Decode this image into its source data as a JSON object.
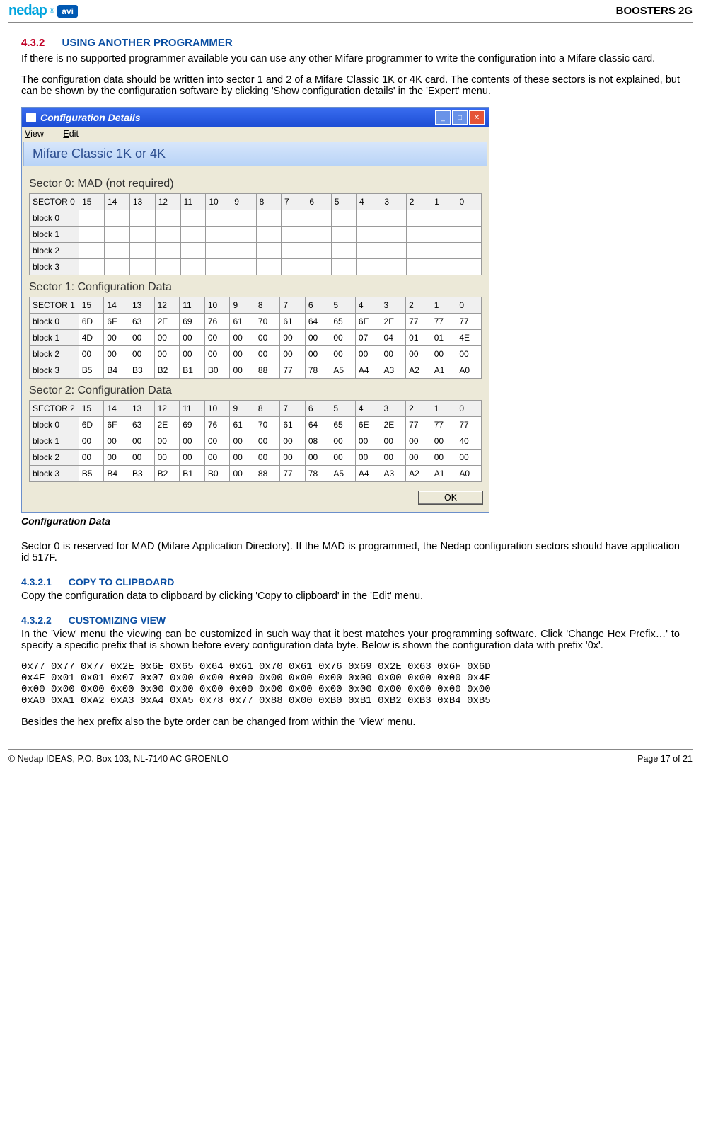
{
  "header": {
    "logo_text": "nedap",
    "logo_badge": "avi",
    "right_text": "BOOSTERS 2G"
  },
  "section": {
    "num": "4.3.2",
    "title": "USING ANOTHER PROGRAMMER"
  },
  "para1": "If there is no supported programmer available you can use any other Mifare programmer to write the configuration into a Mifare classic card.",
  "para2": "The configuration data should be written into sector 1 and 2 of a Mifare Classic 1K or 4K card. The contents of these sectors is not explained, but can be shown by the configuration software by clicking 'Show configuration details' in the 'Expert' menu.",
  "window": {
    "title": "Configuration Details",
    "menus": [
      "View",
      "Edit"
    ],
    "strip": "Mifare Classic 1K or 4K",
    "ok_label": "OK",
    "sectors": [
      {
        "label": "Sector 0: MAD (not required)",
        "header_label": "SECTOR 0",
        "cols": [
          "15",
          "14",
          "13",
          "12",
          "11",
          "10",
          "9",
          "8",
          "7",
          "6",
          "5",
          "4",
          "3",
          "2",
          "1",
          "0"
        ],
        "rows": [
          {
            "label": "block 0",
            "vals": [
              "",
              "",
              "",
              "",
              "",
              "",
              "",
              "",
              "",
              "",
              "",
              "",
              "",
              "",
              "",
              ""
            ]
          },
          {
            "label": "block 1",
            "vals": [
              "",
              "",
              "",
              "",
              "",
              "",
              "",
              "",
              "",
              "",
              "",
              "",
              "",
              "",
              "",
              ""
            ]
          },
          {
            "label": "block 2",
            "vals": [
              "",
              "",
              "",
              "",
              "",
              "",
              "",
              "",
              "",
              "",
              "",
              "",
              "",
              "",
              "",
              ""
            ]
          },
          {
            "label": "block 3",
            "vals": [
              "",
              "",
              "",
              "",
              "",
              "",
              "",
              "",
              "",
              "",
              "",
              "",
              "",
              "",
              "",
              ""
            ]
          }
        ]
      },
      {
        "label": "Sector 1: Configuration Data",
        "header_label": "SECTOR 1",
        "cols": [
          "15",
          "14",
          "13",
          "12",
          "11",
          "10",
          "9",
          "8",
          "7",
          "6",
          "5",
          "4",
          "3",
          "2",
          "1",
          "0"
        ],
        "rows": [
          {
            "label": "block 0",
            "vals": [
              "6D",
              "6F",
              "63",
              "2E",
              "69",
              "76",
              "61",
              "70",
              "61",
              "64",
              "65",
              "6E",
              "2E",
              "77",
              "77",
              "77"
            ]
          },
          {
            "label": "block 1",
            "vals": [
              "4D",
              "00",
              "00",
              "00",
              "00",
              "00",
              "00",
              "00",
              "00",
              "00",
              "00",
              "07",
              "04",
              "01",
              "01",
              "4E"
            ]
          },
          {
            "label": "block 2",
            "vals": [
              "00",
              "00",
              "00",
              "00",
              "00",
              "00",
              "00",
              "00",
              "00",
              "00",
              "00",
              "00",
              "00",
              "00",
              "00",
              "00"
            ]
          },
          {
            "label": "block 3",
            "vals": [
              "B5",
              "B4",
              "B3",
              "B2",
              "B1",
              "B0",
              "00",
              "88",
              "77",
              "78",
              "A5",
              "A4",
              "A3",
              "A2",
              "A1",
              "A0"
            ]
          }
        ]
      },
      {
        "label": "Sector 2: Configuration Data",
        "header_label": "SECTOR 2",
        "cols": [
          "15",
          "14",
          "13",
          "12",
          "11",
          "10",
          "9",
          "8",
          "7",
          "6",
          "5",
          "4",
          "3",
          "2",
          "1",
          "0"
        ],
        "rows": [
          {
            "label": "block 0",
            "vals": [
              "6D",
              "6F",
              "63",
              "2E",
              "69",
              "76",
              "61",
              "70",
              "61",
              "64",
              "65",
              "6E",
              "2E",
              "77",
              "77",
              "77"
            ]
          },
          {
            "label": "block 1",
            "vals": [
              "00",
              "00",
              "00",
              "00",
              "00",
              "00",
              "00",
              "00",
              "00",
              "08",
              "00",
              "00",
              "00",
              "00",
              "00",
              "40"
            ]
          },
          {
            "label": "block 2",
            "vals": [
              "00",
              "00",
              "00",
              "00",
              "00",
              "00",
              "00",
              "00",
              "00",
              "00",
              "00",
              "00",
              "00",
              "00",
              "00",
              "00"
            ]
          },
          {
            "label": "block 3",
            "vals": [
              "B5",
              "B4",
              "B3",
              "B2",
              "B1",
              "B0",
              "00",
              "88",
              "77",
              "78",
              "A5",
              "A4",
              "A3",
              "A2",
              "A1",
              "A0"
            ]
          }
        ]
      }
    ]
  },
  "figure_label": "Configuration Data",
  "para3": "Sector 0 is reserved for MAD (Mifare Application Directory). If the MAD is programmed, the Nedap configuration sectors should have application id 517F.",
  "sub1": {
    "num": "4.3.2.1",
    "title": "COPY TO CLIPBOARD"
  },
  "para4": "Copy the configuration data to clipboard by clicking 'Copy to clipboard' in the 'Edit' menu.",
  "sub2": {
    "num": "4.3.2.2",
    "title": "CUSTOMIZING VIEW"
  },
  "para5": "In the 'View' menu the viewing can be customized in such way that it best matches your programming software. Click 'Change Hex Prefix…' to specify a specific prefix that is shown before every configuration data byte. Below is shown the configuration data with prefix '0x'.",
  "hexblock": "0x77 0x77 0x77 0x2E 0x6E 0x65 0x64 0x61 0x70 0x61 0x76 0x69 0x2E 0x63 0x6F 0x6D\n0x4E 0x01 0x01 0x07 0x07 0x00 0x00 0x00 0x00 0x00 0x00 0x00 0x00 0x00 0x00 0x4E\n0x00 0x00 0x00 0x00 0x00 0x00 0x00 0x00 0x00 0x00 0x00 0x00 0x00 0x00 0x00 0x00\n0xA0 0xA1 0xA2 0xA3 0xA4 0xA5 0x78 0x77 0x88 0x00 0xB0 0xB1 0xB2 0xB3 0xB4 0xB5",
  "para6": "Besides the hex prefix also the byte order can be changed from within the 'View' menu.",
  "footer": {
    "left": "© Nedap IDEAS, P.O. Box 103, NL-7140 AC GROENLO",
    "right": "Page 17 of 21"
  }
}
